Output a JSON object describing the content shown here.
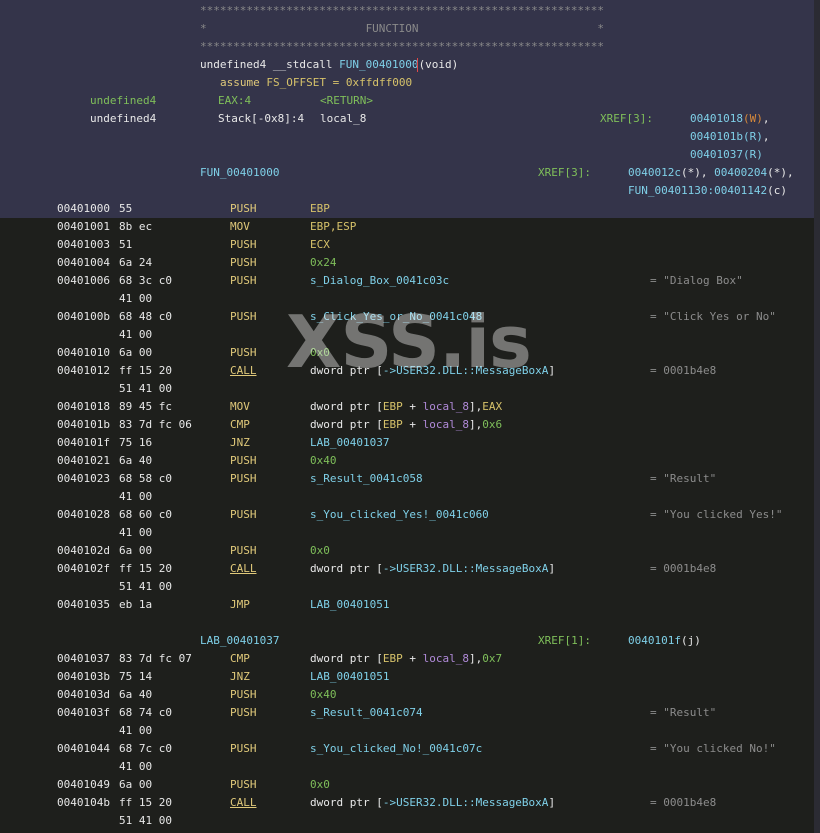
{
  "header": {
    "stars_line": "*************************************************************",
    "banner": "*                        FUNCTION                           *",
    "sig_type": "undefined4 __stdcall ",
    "sig_name": "FUN_00401000",
    "sig_args": "(void)",
    "assume_kw": "assume",
    "assume_rest": " FS_OFFSET = 0xffdff000",
    "ret_type": "undefined4",
    "ret_loc": "EAX:4",
    "ret_name": "<RETURN>",
    "local_type": "undefined4",
    "local_loc": "Stack[-0x8]:4",
    "local_name": "local_8",
    "local_xref_label": "XREF[3]:",
    "local_xrefs": [
      "00401018",
      "0040101b",
      "00401037"
    ],
    "local_xref_kinds": [
      "(W)",
      "(R)",
      "(R)"
    ],
    "local_xref_trailers": [
      ",",
      ",",
      ""
    ],
    "func_label": "FUN_00401000",
    "func_xref_label": "XREF[3]:",
    "func_xref_line1a": "0040012c",
    "func_xref_line1b": "(*), ",
    "func_xref_line1c": "00400204",
    "func_xref_line1d": "(*),",
    "func_xref_line2": "FUN_00401130:00401142",
    "func_xref_line2b": "(c)"
  },
  "listing": {
    "rows": [
      {
        "addr": "00401000",
        "bytes": "55",
        "mnem": "PUSH",
        "op": "EBP",
        "opc": "yellow",
        "cmt": ""
      },
      {
        "addr": "00401001",
        "bytes": "8b ec",
        "mnem": "MOV",
        "op": "EBP,ESP",
        "opc": "yellow",
        "cmt": ""
      },
      {
        "addr": "00401003",
        "bytes": "51",
        "mnem": "PUSH",
        "op": "ECX",
        "opc": "yellow",
        "cmt": ""
      },
      {
        "addr": "00401004",
        "bytes": "6a 24",
        "mnem": "PUSH",
        "op": "0x24",
        "opc": "green",
        "cmt": ""
      },
      {
        "addr": "00401006",
        "bytes": "68 3c c0",
        "mnem": "PUSH",
        "op": "s_Dialog_Box_0041c03c",
        "opc": "cyan",
        "cmt": "= \"Dialog Box\""
      },
      {
        "addr": "",
        "bytes": "41 00",
        "mnem": "",
        "op": "",
        "opc": "",
        "cmt": ""
      },
      {
        "addr": "0040100b",
        "bytes": "68 48 c0",
        "mnem": "PUSH",
        "op": "s_Click_Yes_or_No_0041c048",
        "opc": "cyan",
        "cmt": "= \"Click Yes or No\""
      },
      {
        "addr": "",
        "bytes": "41 00",
        "mnem": "",
        "op": "",
        "opc": "",
        "cmt": ""
      },
      {
        "addr": "00401010",
        "bytes": "6a 00",
        "mnem": "PUSH",
        "op": "0x0",
        "opc": "green",
        "cmt": ""
      },
      {
        "addr": "00401012",
        "bytes": "ff 15 20",
        "mnem": "CALL",
        "op": "dword ptr [->USER32.DLL::MessageBoxA]",
        "opc": "call",
        "cmt": "= 0001b4e8"
      },
      {
        "addr": "",
        "bytes": "51 41 00",
        "mnem": "",
        "op": "",
        "opc": "",
        "cmt": ""
      },
      {
        "addr": "00401018",
        "bytes": "89 45 fc",
        "mnem": "MOV",
        "op": "dword ptr [EBP + local_8],EAX",
        "opc": "mem",
        "cmt": ""
      },
      {
        "addr": "0040101b",
        "bytes": "83 7d fc 06",
        "mnem": "CMP",
        "op": "dword ptr [EBP + local_8],0x6",
        "opc": "mem",
        "cmt": ""
      },
      {
        "addr": "0040101f",
        "bytes": "75 16",
        "mnem": "JNZ",
        "op": "LAB_00401037",
        "opc": "cyan",
        "cmt": ""
      },
      {
        "addr": "00401021",
        "bytes": "6a 40",
        "mnem": "PUSH",
        "op": "0x40",
        "opc": "green",
        "cmt": ""
      },
      {
        "addr": "00401023",
        "bytes": "68 58 c0",
        "mnem": "PUSH",
        "op": "s_Result_0041c058",
        "opc": "cyan",
        "cmt": "= \"Result\""
      },
      {
        "addr": "",
        "bytes": "41 00",
        "mnem": "",
        "op": "",
        "opc": "",
        "cmt": ""
      },
      {
        "addr": "00401028",
        "bytes": "68 60 c0",
        "mnem": "PUSH",
        "op": "s_You_clicked_Yes!_0041c060",
        "opc": "cyan",
        "cmt": "= \"You clicked Yes!\""
      },
      {
        "addr": "",
        "bytes": "41 00",
        "mnem": "",
        "op": "",
        "opc": "",
        "cmt": ""
      },
      {
        "addr": "0040102d",
        "bytes": "6a 00",
        "mnem": "PUSH",
        "op": "0x0",
        "opc": "green",
        "cmt": ""
      },
      {
        "addr": "0040102f",
        "bytes": "ff 15 20",
        "mnem": "CALL",
        "op": "dword ptr [->USER32.DLL::MessageBoxA]",
        "opc": "call",
        "cmt": "= 0001b4e8"
      },
      {
        "addr": "",
        "bytes": "51 41 00",
        "mnem": "",
        "op": "",
        "opc": "",
        "cmt": ""
      },
      {
        "addr": "00401035",
        "bytes": "eb 1a",
        "mnem": "JMP",
        "op": "LAB_00401051",
        "opc": "cyan",
        "cmt": ""
      },
      {
        "addr": "",
        "bytes": "",
        "mnem": "",
        "op": "",
        "opc": "",
        "cmt": ""
      },
      {
        "label": "LAB_00401037",
        "xref_label": "XREF[1]:",
        "xref": "0040101f",
        "xref_kind": "(j)"
      },
      {
        "addr": "00401037",
        "bytes": "83 7d fc 07",
        "mnem": "CMP",
        "op": "dword ptr [EBP + local_8],0x7",
        "opc": "mem",
        "cmt": ""
      },
      {
        "addr": "0040103b",
        "bytes": "75 14",
        "mnem": "JNZ",
        "op": "LAB_00401051",
        "opc": "cyan",
        "cmt": ""
      },
      {
        "addr": "0040103d",
        "bytes": "6a 40",
        "mnem": "PUSH",
        "op": "0x40",
        "opc": "green",
        "cmt": ""
      },
      {
        "addr": "0040103f",
        "bytes": "68 74 c0",
        "mnem": "PUSH",
        "op": "s_Result_0041c074",
        "opc": "cyan",
        "cmt": "= \"Result\""
      },
      {
        "addr": "",
        "bytes": "41 00",
        "mnem": "",
        "op": "",
        "opc": "",
        "cmt": ""
      },
      {
        "addr": "00401044",
        "bytes": "68 7c c0",
        "mnem": "PUSH",
        "op": "s_You_clicked_No!_0041c07c",
        "opc": "cyan",
        "cmt": "= \"You clicked No!\""
      },
      {
        "addr": "",
        "bytes": "41 00",
        "mnem": "",
        "op": "",
        "opc": "",
        "cmt": ""
      },
      {
        "addr": "00401049",
        "bytes": "6a 00",
        "mnem": "PUSH",
        "op": "0x0",
        "opc": "green",
        "cmt": ""
      },
      {
        "addr": "0040104b",
        "bytes": "ff 15 20",
        "mnem": "CALL",
        "op": "dword ptr [->USER32.DLL::MessageBoxA]",
        "opc": "call",
        "cmt": "= 0001b4e8"
      },
      {
        "addr": "",
        "bytes": "51 41 00",
        "mnem": "",
        "op": "",
        "opc": "",
        "cmt": ""
      }
    ]
  },
  "watermark": "XSS.is",
  "colors": {
    "background": "#1e1f1c",
    "header_background": "#34344a",
    "mnemonic": "#e0c97a",
    "register": "#d6c26a",
    "constant": "#7fbf5a",
    "reference": "#7fd0e8",
    "local_var": "#b08ad8",
    "comment": "#8c8c8c",
    "xref_kind": "#d98a3a",
    "cursor": "#e04848"
  }
}
